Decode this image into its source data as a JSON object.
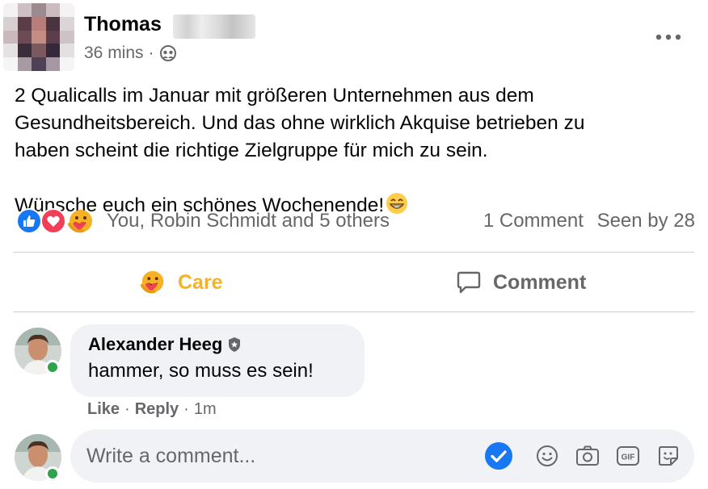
{
  "post": {
    "author_first_name": "Thomas",
    "time": "36 mins",
    "separator": "·",
    "audience_icon": "friends-icon",
    "body": "2 Qualicalls im Januar mit größeren Unternehmen aus dem\nGesundheitsbereich. Und das ohne wirklich Akquise betrieben zu\nhaben scheint die richtige Zielgruppe für mich zu sein.\nWünsche euch ein schönes Wochenende!",
    "body_emoji": "😁",
    "more_icon": "more-options-icon"
  },
  "reactions": {
    "icons": [
      "like-icon",
      "love-icon",
      "care-icon"
    ],
    "names": "You, Robin Schmidt and 5 others",
    "comments": "1 Comment",
    "seen_by": "Seen by 28"
  },
  "actions": {
    "care_label": "Care",
    "comment_label": "Comment"
  },
  "comments": [
    {
      "name": "Alexander Heeg",
      "text": "hammer, so muss es sein!",
      "like": "Like",
      "reply": "Reply",
      "time": "1m",
      "sep": "·"
    }
  ],
  "composer": {
    "placeholder": "Write a comment...",
    "icons": [
      "check-icon",
      "emoji-icon",
      "camera-icon",
      "gif-icon",
      "sticker-icon"
    ]
  },
  "colors": {
    "care": "#f7b125",
    "like_blue": "#1877f2",
    "love_red": "#f33e58",
    "online": "#31a24c",
    "secondary_text": "#65676b"
  }
}
